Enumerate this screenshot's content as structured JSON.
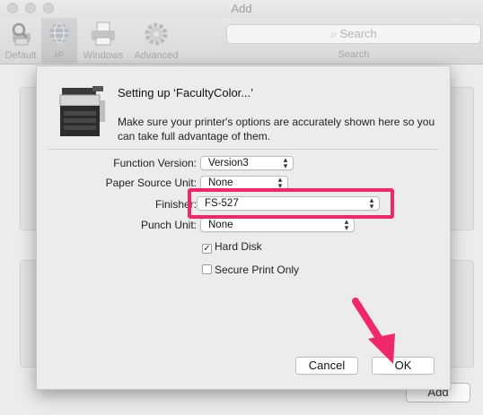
{
  "window": {
    "title": "Add",
    "toolbar": {
      "items": [
        {
          "label": "Default"
        },
        {
          "label": "IP"
        },
        {
          "label": "Windows"
        },
        {
          "label": "Advanced"
        }
      ],
      "search_placeholder": "Search",
      "search_caption": "Search"
    },
    "add_button_label": "Add"
  },
  "sheet": {
    "title": "Setting up ‘FacultyColor...’",
    "description": "Make sure your printer's options are accurately shown here so you can take full advantage of them.",
    "options": [
      {
        "label": "Function Version:",
        "value": "Version3"
      },
      {
        "label": "Paper Source Unit:",
        "value": "None"
      },
      {
        "label": "Finisher:",
        "value": "FS-527"
      },
      {
        "label": "Punch Unit:",
        "value": "None"
      }
    ],
    "checkboxes": [
      {
        "label": "Hard Disk",
        "checked": true,
        "mark": "✓"
      },
      {
        "label": "Secure Print Only",
        "checked": false,
        "mark": ""
      }
    ],
    "cancel_label": "Cancel",
    "ok_label": "OK"
  },
  "annotation": {
    "highlight_color": "#f0286b",
    "arrow_color": "#f0286b"
  }
}
